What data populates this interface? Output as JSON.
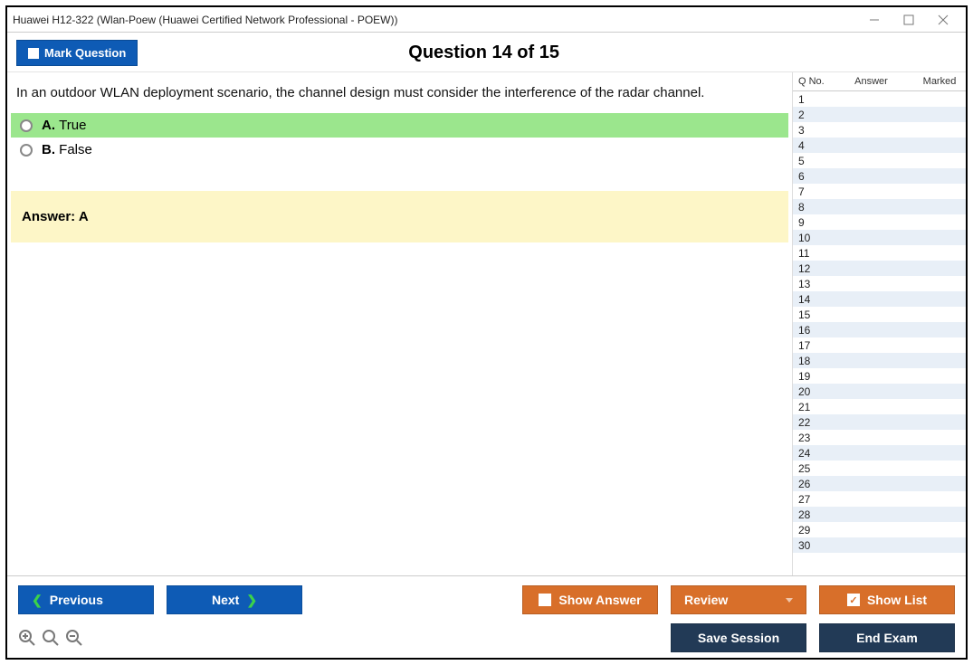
{
  "window": {
    "title": "Huawei H12-322 (Wlan-Poew (Huawei Certified Network Professional - POEW))"
  },
  "header": {
    "mark_question": "Mark Question",
    "question_title": "Question 14 of 15"
  },
  "question": {
    "text": "In an outdoor WLAN deployment scenario, the channel design must consider the interference of the radar channel.",
    "options": [
      {
        "letter": "A.",
        "text": "True",
        "selected": true
      },
      {
        "letter": "B.",
        "text": "False",
        "selected": false
      }
    ],
    "answer_label": "Answer:",
    "answer_value": "A"
  },
  "sidebar": {
    "headers": {
      "qno": "Q No.",
      "answer": "Answer",
      "marked": "Marked"
    },
    "rows": [
      {
        "n": "1"
      },
      {
        "n": "2"
      },
      {
        "n": "3"
      },
      {
        "n": "4"
      },
      {
        "n": "5"
      },
      {
        "n": "6"
      },
      {
        "n": "7"
      },
      {
        "n": "8"
      },
      {
        "n": "9"
      },
      {
        "n": "10"
      },
      {
        "n": "11"
      },
      {
        "n": "12"
      },
      {
        "n": "13"
      },
      {
        "n": "14"
      },
      {
        "n": "15"
      },
      {
        "n": "16"
      },
      {
        "n": "17"
      },
      {
        "n": "18"
      },
      {
        "n": "19"
      },
      {
        "n": "20"
      },
      {
        "n": "21"
      },
      {
        "n": "22"
      },
      {
        "n": "23"
      },
      {
        "n": "24"
      },
      {
        "n": "25"
      },
      {
        "n": "26"
      },
      {
        "n": "27"
      },
      {
        "n": "28"
      },
      {
        "n": "29"
      },
      {
        "n": "30"
      }
    ]
  },
  "buttons": {
    "previous": "Previous",
    "next": "Next",
    "show_answer": "Show Answer",
    "review": "Review",
    "show_list": "Show List",
    "save_session": "Save Session",
    "end_exam": "End Exam"
  }
}
